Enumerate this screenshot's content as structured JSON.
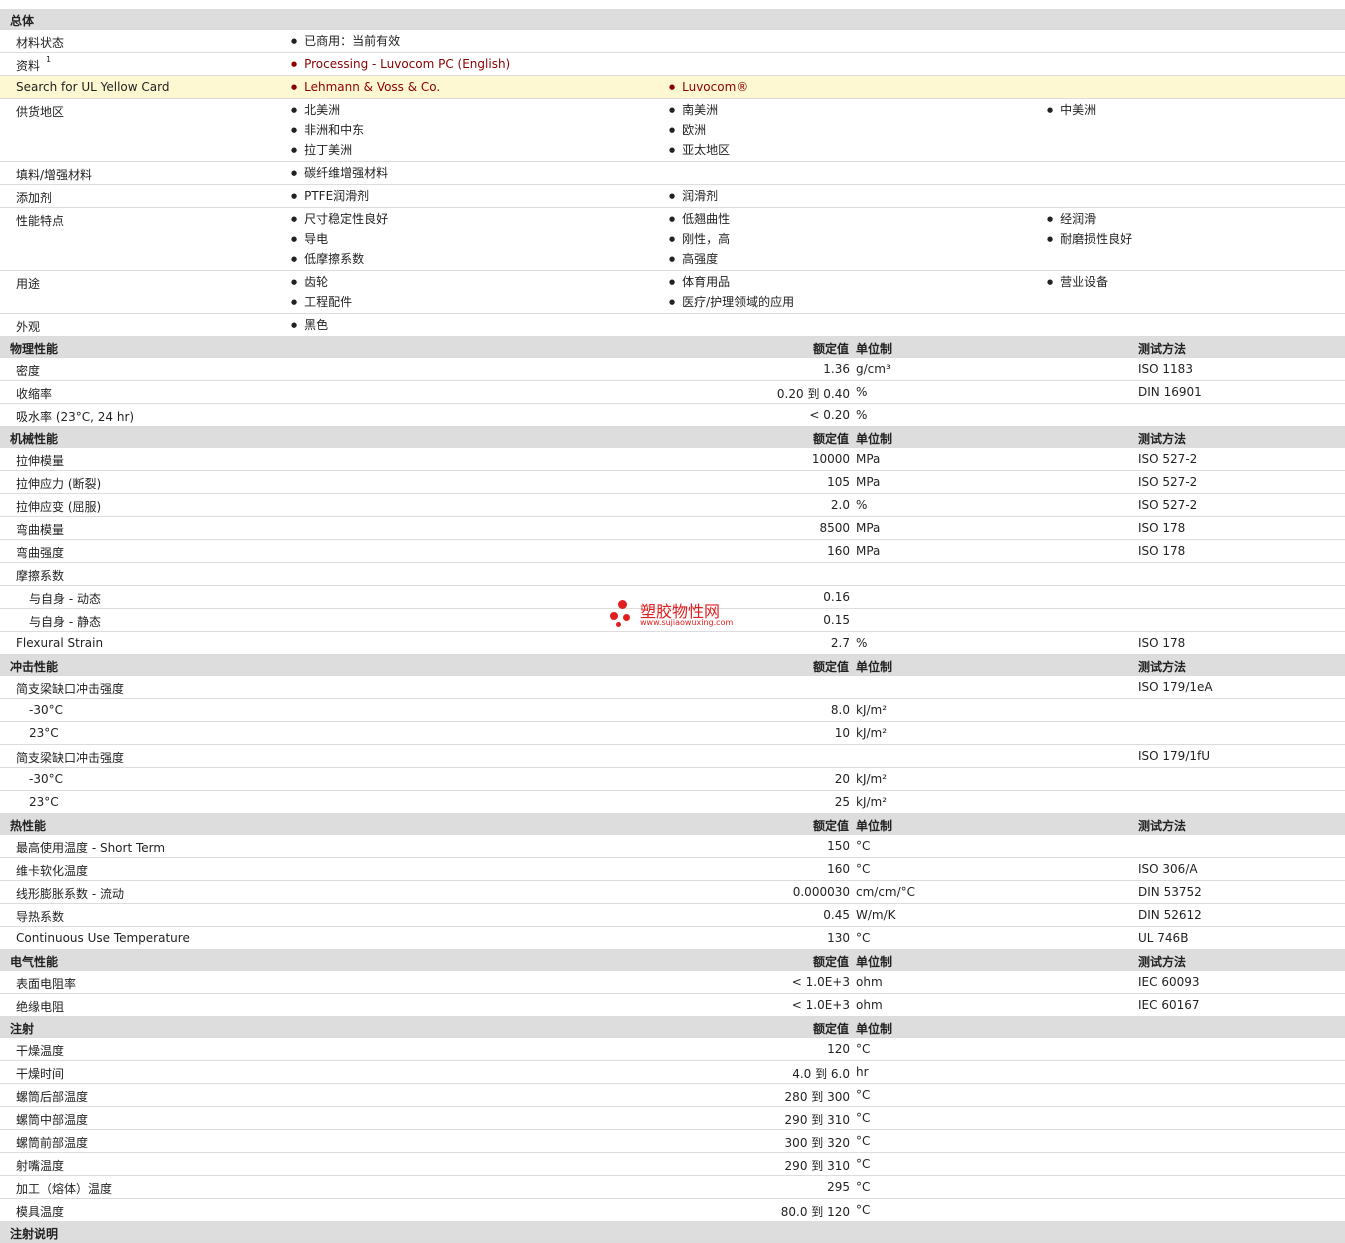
{
  "general": {
    "title": "总体",
    "rows": [
      {
        "label": "材料状态",
        "cols": [
          [
            "已商用：当前有效"
          ],
          [],
          []
        ]
      },
      {
        "label": "资料",
        "sup": "1",
        "link": true,
        "cols": [
          [
            "Processing - Luvocom PC (English)"
          ],
          [],
          []
        ]
      },
      {
        "label": "Search for UL Yellow Card",
        "link": true,
        "highlight": true,
        "cols": [
          [
            "Lehmann & Voss & Co."
          ],
          [
            "Luvocom®"
          ],
          []
        ]
      },
      {
        "label": "供货地区",
        "cols": [
          [
            "北美洲",
            "非洲和中东",
            "拉丁美洲"
          ],
          [
            "南美洲",
            "欧洲",
            "亚太地区"
          ],
          [
            "中美洲"
          ]
        ]
      },
      {
        "label": "填料/增强材料",
        "cols": [
          [
            "碳纤维增强材料"
          ],
          [],
          []
        ]
      },
      {
        "label": "添加剂",
        "cols": [
          [
            "PTFE润滑剂"
          ],
          [
            "润滑剂"
          ],
          []
        ]
      },
      {
        "label": "性能特点",
        "cols": [
          [
            "尺寸稳定性良好",
            "导电",
            "低摩擦系数"
          ],
          [
            "低翘曲性",
            "刚性，高",
            "高强度"
          ],
          [
            "经润滑",
            "耐磨损性良好"
          ]
        ]
      },
      {
        "label": "用途",
        "cols": [
          [
            "齿轮",
            "工程配件"
          ],
          [
            "体育用品",
            "医疗/护理领域的应用"
          ],
          [
            "营业设备"
          ]
        ]
      },
      {
        "label": "外观",
        "cols": [
          [
            "黑色"
          ],
          [],
          []
        ]
      }
    ]
  },
  "sections": [
    {
      "title": "物理性能",
      "value_header": "额定值",
      "unit_header": "单位制",
      "method_header": "测试方法",
      "rows": [
        {
          "label": "密度",
          "value": "1.36",
          "unit": "g/cm³",
          "method": "ISO 1183"
        },
        {
          "label": "收缩率",
          "value": "0.20 到  0.40",
          "unit": "%",
          "method": "DIN 16901"
        },
        {
          "label": "吸水率  (23°C, 24 hr)",
          "value": "< 0.20",
          "unit": "%",
          "method": ""
        }
      ]
    },
    {
      "title": "机械性能",
      "value_header": "额定值",
      "unit_header": "单位制",
      "method_header": "测试方法",
      "rows": [
        {
          "label": "拉伸模量",
          "value": "10000",
          "unit": "MPa",
          "method": "ISO 527-2"
        },
        {
          "label": "拉伸应力  (断裂)",
          "value": "105",
          "unit": "MPa",
          "method": "ISO 527-2"
        },
        {
          "label": "拉伸应变  (屈服)",
          "value": "2.0",
          "unit": "%",
          "method": "ISO 527-2"
        },
        {
          "label": "弯曲模量",
          "value": "8500",
          "unit": "MPa",
          "method": "ISO 178"
        },
        {
          "label": "弯曲强度",
          "value": "160",
          "unit": "MPa",
          "method": "ISO 178"
        },
        {
          "label": "摩擦系数",
          "value": "",
          "unit": "",
          "method": ""
        },
        {
          "label": "与自身  - 动态",
          "sub": true,
          "value": "0.16",
          "unit": "",
          "method": ""
        },
        {
          "label": "与自身  - 静态",
          "sub": true,
          "value": "0.15",
          "unit": "",
          "method": ""
        },
        {
          "label": "Flexural Strain",
          "value": "2.7",
          "unit": "%",
          "method": "ISO 178"
        }
      ]
    },
    {
      "title": "冲击性能",
      "value_header": "额定值",
      "unit_header": "单位制",
      "method_header": "测试方法",
      "rows": [
        {
          "label": "简支梁缺口冲击强度",
          "value": "",
          "unit": "",
          "method": "ISO 179/1eA"
        },
        {
          "label": "-30°C",
          "sub": true,
          "value": "8.0",
          "unit": "kJ/m²",
          "method": ""
        },
        {
          "label": "23°C",
          "sub": true,
          "value": "10",
          "unit": "kJ/m²",
          "method": ""
        },
        {
          "label": "简支梁缺口冲击强度",
          "value": "",
          "unit": "",
          "method": "ISO 179/1fU"
        },
        {
          "label": "-30°C",
          "sub": true,
          "value": "20",
          "unit": "kJ/m²",
          "method": ""
        },
        {
          "label": "23°C",
          "sub": true,
          "value": "25",
          "unit": "kJ/m²",
          "method": ""
        }
      ]
    },
    {
      "title": "热性能",
      "value_header": "额定值",
      "unit_header": "单位制",
      "method_header": "测试方法",
      "rows": [
        {
          "label": "最高使用温度  - Short Term",
          "value": "150",
          "unit": "°C",
          "method": ""
        },
        {
          "label": "维卡软化温度",
          "value": "160",
          "unit": "°C",
          "method": "ISO 306/A"
        },
        {
          "label": "线形膨胀系数  - 流动",
          "value": "0.000030",
          "unit": "cm/cm/°C",
          "method": "DIN 53752"
        },
        {
          "label": "导热系数",
          "value": "0.45",
          "unit": "W/m/K",
          "method": "DIN 52612"
        },
        {
          "label": "Continuous Use Temperature",
          "value": "130",
          "unit": "°C",
          "method": "UL 746B"
        }
      ]
    },
    {
      "title": "电气性能",
      "value_header": "额定值",
      "unit_header": "单位制",
      "method_header": "测试方法",
      "rows": [
        {
          "label": "表面电阻率",
          "value": "< 1.0E+3",
          "unit": "ohm",
          "method": "IEC 60093"
        },
        {
          "label": "绝缘电阻",
          "value": "< 1.0E+3",
          "unit": "ohm",
          "method": "IEC 60167"
        }
      ]
    },
    {
      "title": "注射",
      "value_header": "额定值",
      "unit_header": "单位制",
      "method_header": "",
      "rows": [
        {
          "label": "干燥温度",
          "value": "120",
          "unit": "°C",
          "method": ""
        },
        {
          "label": "干燥时间",
          "value": "4.0 到  6.0",
          "unit": "hr",
          "method": ""
        },
        {
          "label": "螺筒后部温度",
          "value": "280 到  300",
          "unit": "°C",
          "method": ""
        },
        {
          "label": "螺筒中部温度",
          "value": "290 到  310",
          "unit": "°C",
          "method": ""
        },
        {
          "label": "螺筒前部温度",
          "value": "300 到  320",
          "unit": "°C",
          "method": ""
        },
        {
          "label": "射嘴温度",
          "value": "290 到  310",
          "unit": "°C",
          "method": ""
        },
        {
          "label": "加工（熔体）温度",
          "value": "295",
          "unit": "°C",
          "method": ""
        },
        {
          "label": "模具温度",
          "value": "80.0 到  120",
          "unit": "°C",
          "method": ""
        }
      ]
    },
    {
      "title": "注射说明",
      "value_header": "",
      "unit_header": "",
      "method_header": "",
      "rows": []
    }
  ],
  "watermark": {
    "title": "塑胶物性网",
    "url": "www.sujiaowuxing.com"
  }
}
